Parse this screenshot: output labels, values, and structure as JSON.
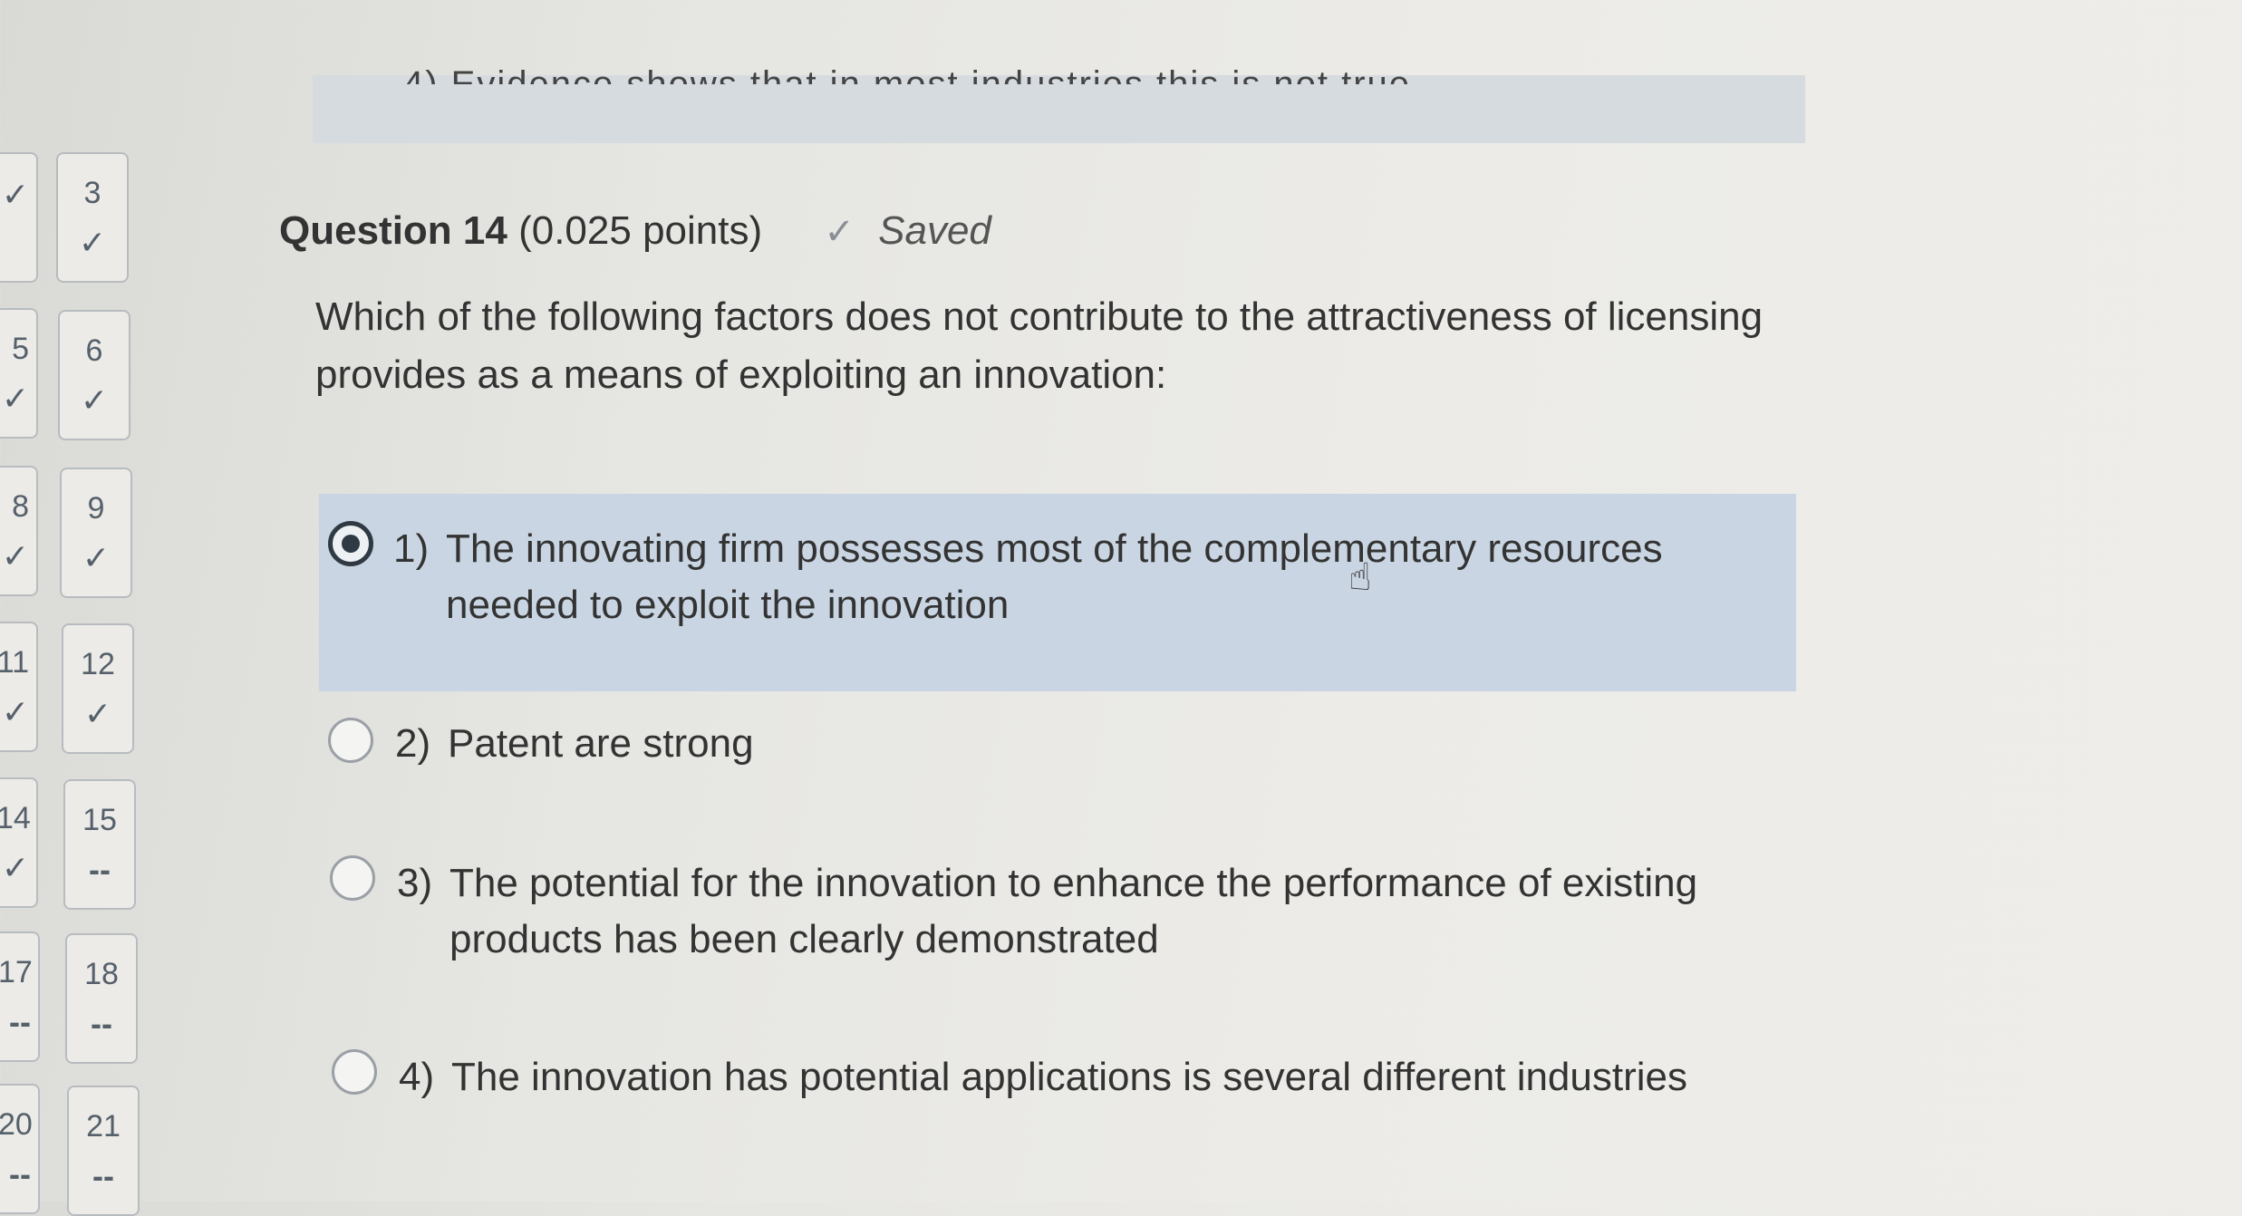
{
  "previous_question": {
    "cut_text": "4) Evidence shows that in most industries this is not true"
  },
  "nav_tiles": [
    {
      "number": "3",
      "status": "✓"
    },
    {
      "number": "6",
      "status": "✓"
    },
    {
      "number": "9",
      "status": "✓"
    },
    {
      "number": "12",
      "status": "✓"
    },
    {
      "number": "15",
      "status": "--"
    },
    {
      "number": "18",
      "status": "--"
    },
    {
      "number": "21",
      "status": "--"
    }
  ],
  "nav_tiles_left_cut": [
    {
      "number": "",
      "status": "✓"
    },
    {
      "number": "5",
      "status": "✓"
    },
    {
      "number": "8",
      "status": "✓"
    },
    {
      "number": "11",
      "status": "✓"
    },
    {
      "number": "14",
      "status": "✓"
    },
    {
      "number": "17",
      "status": "--"
    },
    {
      "number": "20",
      "status": "--"
    }
  ],
  "question": {
    "title": "Question 14",
    "points": "(0.025 points)",
    "saved_icon": "checkmark-icon",
    "saved_label": "Saved",
    "text": "Which of the following factors does not contribute to the attractiveness of licensing provides as a means of exploiting an innovation:"
  },
  "options": [
    {
      "num": "1)",
      "text": "The innovating firm possesses most of the complementary resources needed to exploit the innovation",
      "selected": true
    },
    {
      "num": "2)",
      "text": "Patent are strong",
      "selected": false
    },
    {
      "num": "3)",
      "text": "The potential for the innovation to enhance the performance of existing products has been clearly demonstrated",
      "selected": false
    },
    {
      "num": "4)",
      "text": "The innovation has potential applications is several different industries",
      "selected": false
    }
  ],
  "colors": {
    "selected_bg": "#c9d5e2",
    "radio_on": "#2f3a44"
  }
}
